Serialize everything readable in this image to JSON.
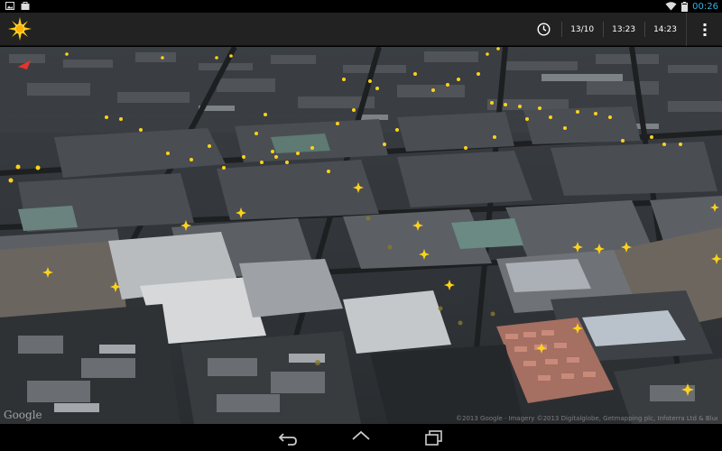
{
  "status_bar": {
    "time": "00:26",
    "left_icons": [
      "image-notification-icon",
      "bag-notification-icon"
    ],
    "right_icons": [
      "wifi-icon",
      "battery-icon"
    ]
  },
  "action_bar": {
    "app_icon": "sun-logo-icon",
    "clock_icon": "clock-icon",
    "date_label": "13/10",
    "time_start_label": "13:23",
    "time_end_label": "14:23",
    "menu_icon": "overflow-menu-icon"
  },
  "map": {
    "logo_text": "Google",
    "attribution_text": "©2013 Google · Imagery ©2013 Digitalglobe, Getmapping plc, Infoterra Ltd & Bluesky, Lantmäteriet/Metria"
  },
  "nav_bar": {
    "icons": [
      "back-icon",
      "home-icon",
      "recent-apps-icon"
    ]
  },
  "colors": {
    "accent_clock": "#33b5e5",
    "marker_yellow": "#ffd21a",
    "action_bar_bg": "#222222"
  }
}
